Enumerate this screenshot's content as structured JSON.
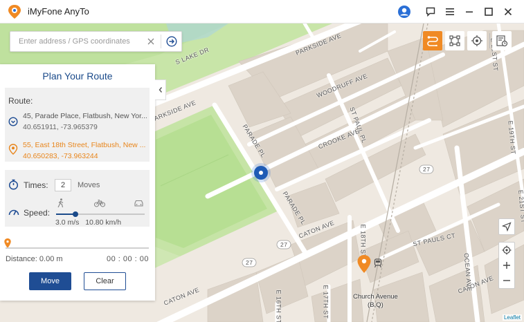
{
  "app": {
    "title": "iMyFone AnyTo"
  },
  "search": {
    "placeholder": "Enter address / GPS coordinates"
  },
  "panel": {
    "title": "Plan Your Route",
    "route_label": "Route:",
    "start": {
      "address": "45, Parade Place, Flatbush, New Yor...",
      "coords": "40.651911, -73.965379"
    },
    "destination": {
      "address": "55, East 18th Street, Flatbush, New ...",
      "coords": "40.650283, -73.963244"
    },
    "times_label": "Times:",
    "times_value": "2",
    "moves_label": "Moves",
    "speed_label": "Speed:",
    "speed_ms": "3.0 m/s",
    "speed_kmh": "10.80 km/h",
    "speed_level": 0.22,
    "progress": 0,
    "distance": "Distance: 0.00 m",
    "elapsed": "00 : 00 : 00",
    "move_label": "Move",
    "clear_label": "Clear"
  },
  "map": {
    "streets": {
      "parkside_top": "PARKSIDE AVE",
      "parkside_left": "PARKSIDE AVE",
      "s_lake_dr": "S LAKE DR",
      "woodruff": "WOODRUFF AVE",
      "crooke": "CROOKE AVE",
      "parade_pl_1": "PARADE PL",
      "parade_pl_2": "PARADE PL",
      "st_paul_pl": "ST PAUL PL",
      "caton_ave_1": "CATON AVE",
      "caton_ave_2": "CATON AVE",
      "caton_ave_3": "CATON AVE",
      "st_pauls_ct": "ST PAULS CT",
      "e18th": "E 18TH ST",
      "e17th": "E 17TH ST",
      "e16th": "E 16TH ST",
      "ocean_ave": "OCEAN AVE",
      "e21st": "E 21ST ST",
      "e21st_2": "E 21ST ST",
      "e19th": "E 19TH ST"
    },
    "route_badges": [
      "27",
      "27",
      "27"
    ],
    "station": {
      "name": "Church Avenue",
      "lines": "(B,Q)"
    },
    "attribution": "Leaflet"
  },
  "colors": {
    "accent": "#f08a24",
    "primary": "#1f4d94",
    "park": "#c8e5a8",
    "park_field": "#b7df93",
    "map_bg": "#efe9e1",
    "building": "#dcd3c8"
  }
}
